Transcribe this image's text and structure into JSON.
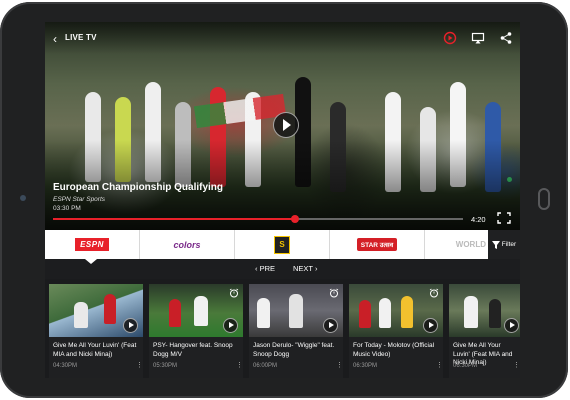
{
  "header": {
    "back_icon": "chevron-left-icon",
    "title": "LIVE TV",
    "icons": [
      "record-icon",
      "cast-icon",
      "share-icon"
    ],
    "accent_color": "#e8212a"
  },
  "video": {
    "title": "European Championship Qualifying",
    "channel": "ESPN Star Sports",
    "time": "03:30 PM",
    "duration": "4:20",
    "progress": 0.59
  },
  "channels": [
    {
      "name": "ESPN"
    },
    {
      "name": "colors"
    },
    {
      "name": "S"
    },
    {
      "name": "STAR उत्सव"
    },
    {
      "name": "WORLD"
    }
  ],
  "filter": {
    "label": "Filter"
  },
  "pager": {
    "prev": "PRE",
    "next": "NEXT"
  },
  "cards": [
    {
      "title": "Give Me All Your Luvin' (Feat MIA and Nicki Minaj)",
      "time": "04:30PM"
    },
    {
      "title": "PSY- Hangover feat. Snoop Dogg M/V",
      "time": "05:30PM"
    },
    {
      "title": "Jason Derulo- \"Wiggle\" feat. Snoop Dogg",
      "time": "06:00PM"
    },
    {
      "title": "For Today - Molotov (Official Music Video)",
      "time": "06:30PM"
    },
    {
      "title": "Give Me All Your Luvin' (Feat MIA and Nicki Minaj)",
      "time": "06:30PM"
    }
  ]
}
